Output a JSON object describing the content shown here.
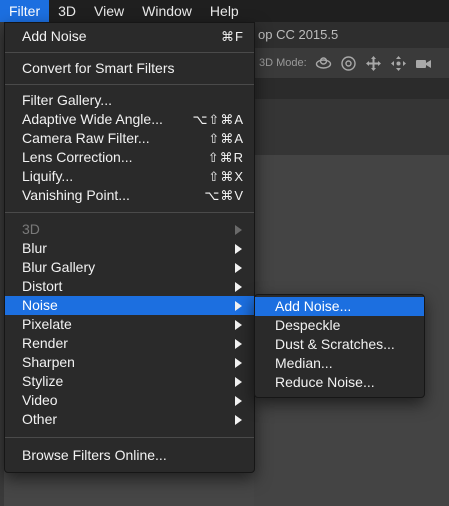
{
  "menubar": {
    "items": [
      {
        "label": "Filter",
        "active": true
      },
      {
        "label": "3D",
        "active": false
      },
      {
        "label": "View",
        "active": false
      },
      {
        "label": "Window",
        "active": false
      },
      {
        "label": "Help",
        "active": false
      }
    ]
  },
  "app": {
    "title_fragment": "op CC 2015.5",
    "mode_label": "3D Mode:",
    "tool_icons": [
      "orbit-icon",
      "roll-icon",
      "pan-icon",
      "slide-icon",
      "video-camera-icon"
    ]
  },
  "filter_menu": {
    "add_noise": {
      "label": "Add Noise",
      "shortcut": "⌘F"
    },
    "convert": {
      "label": "Convert for Smart Filters"
    },
    "filter_gallery": {
      "label": "Filter Gallery..."
    },
    "adaptive_wide_angle": {
      "label": "Adaptive Wide Angle...",
      "shortcut": "⌥⇧⌘A"
    },
    "camera_raw": {
      "label": "Camera Raw Filter...",
      "shortcut": "⇧⌘A"
    },
    "lens_correction": {
      "label": "Lens Correction...",
      "shortcut": "⇧⌘R"
    },
    "liquify": {
      "label": "Liquify...",
      "shortcut": "⇧⌘X"
    },
    "vanishing_point": {
      "label": "Vanishing Point...",
      "shortcut": "⌥⌘V"
    },
    "submenus": [
      {
        "label": "3D",
        "disabled": true
      },
      {
        "label": "Blur",
        "disabled": false
      },
      {
        "label": "Blur Gallery",
        "disabled": false
      },
      {
        "label": "Distort",
        "disabled": false
      },
      {
        "label": "Noise",
        "disabled": false,
        "highlighted": true
      },
      {
        "label": "Pixelate",
        "disabled": false
      },
      {
        "label": "Render",
        "disabled": false
      },
      {
        "label": "Sharpen",
        "disabled": false
      },
      {
        "label": "Stylize",
        "disabled": false
      },
      {
        "label": "Video",
        "disabled": false
      },
      {
        "label": "Other",
        "disabled": false
      }
    ],
    "browse_online": {
      "label": "Browse Filters Online..."
    }
  },
  "noise_submenu": {
    "items": [
      {
        "label": "Add Noise...",
        "highlighted": true
      },
      {
        "label": "Despeckle",
        "highlighted": false
      },
      {
        "label": "Dust & Scratches...",
        "highlighted": false
      },
      {
        "label": "Median...",
        "highlighted": false
      },
      {
        "label": "Reduce Noise...",
        "highlighted": false
      }
    ]
  },
  "colors": {
    "highlight": "#1c6fe0",
    "menu_bg": "#2a2a2a",
    "menubar_bg": "#1f1f1f"
  }
}
